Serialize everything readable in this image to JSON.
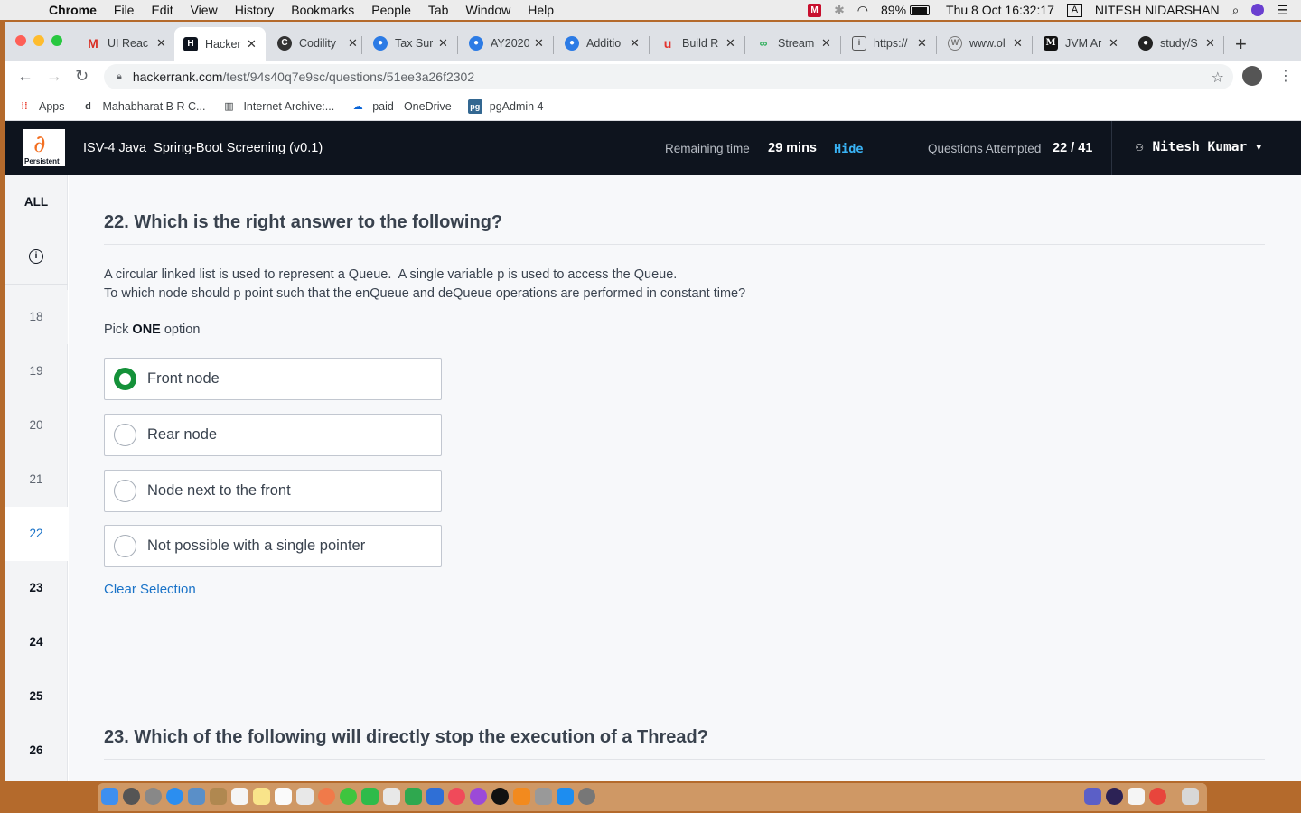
{
  "menubar": {
    "app": "Chrome",
    "menus": [
      "File",
      "Edit",
      "View",
      "History",
      "Bookmarks",
      "People",
      "Tab",
      "Window",
      "Help"
    ],
    "battery": "89%",
    "datetime": "Thu 8 Oct  16:32:17",
    "input_source": "A",
    "user": "NITESH NIDARSHAN"
  },
  "tabs": [
    {
      "title": "UI Reac",
      "icon": "gmail-icon"
    },
    {
      "title": "Hacker",
      "icon": "hackerrank-icon",
      "active": true
    },
    {
      "title": "Codility",
      "icon": "codility-icon"
    },
    {
      "title": "Tax Sur",
      "icon": "tax-portal-icon"
    },
    {
      "title": "AY2020",
      "icon": "tax-portal-icon"
    },
    {
      "title": "Additio",
      "icon": "tax-portal-icon"
    },
    {
      "title": "Build R",
      "icon": "udemy-icon"
    },
    {
      "title": "Stream",
      "icon": "stream-icon"
    },
    {
      "title": "https://",
      "icon": "page-icon"
    },
    {
      "title": "www.ol",
      "icon": "wayback-icon"
    },
    {
      "title": "JVM Ar",
      "icon": "medium-icon"
    },
    {
      "title": "study/S",
      "icon": "github-icon"
    }
  ],
  "address": {
    "host": "hackerrank.com",
    "path": "/test/94s40q7e9sc/questions/51ee3a26f2302"
  },
  "bookmarks": [
    {
      "label": "Apps",
      "icon": "apps-grid-icon"
    },
    {
      "label": "Mahabharat B R C...",
      "icon": "dailymotion-icon"
    },
    {
      "label": "Internet Archive:...",
      "icon": "archive-icon"
    },
    {
      "label": "paid - OneDrive",
      "icon": "onedrive-icon"
    },
    {
      "label": "pgAdmin 4",
      "icon": "pgadmin-icon"
    }
  ],
  "header": {
    "logo_text": "Persistent",
    "test_title": "ISV-4 Java_Spring-Boot Screening (v0.1)",
    "remaining_label": "Remaining time",
    "remaining_value": "29 mins",
    "hide_label": "Hide",
    "attempted_label": "Questions Attempted",
    "attempted_value": "22 / 41",
    "user_name": "Nitesh Kumar"
  },
  "sidenav": {
    "all_label": "ALL",
    "items": [
      "18",
      "19",
      "20",
      "21",
      "22",
      "23",
      "24",
      "25",
      "26"
    ]
  },
  "question": {
    "title": "22. Which is the right answer to the following?",
    "line1": "A circular linked list is used to represent a Queue.  A single variable p is used to access the Queue.",
    "line2": "To which node should p point such that the enQueue and deQueue operations are performed in constant time?",
    "pick_prefix": "Pick ",
    "pick_bold": "ONE",
    "pick_suffix": " option",
    "options": [
      "Front node",
      "Rear node",
      "Node next to the front",
      "Not possible with a single pointer"
    ],
    "selected_index": 0,
    "clear_label": "Clear Selection"
  },
  "next_question": {
    "title": "23. Which of the following will directly stop the execution of a Thread?"
  },
  "colors": {
    "header_bg": "#0e141e",
    "accent_green": "#149139",
    "link_blue": "#1a73c8"
  }
}
